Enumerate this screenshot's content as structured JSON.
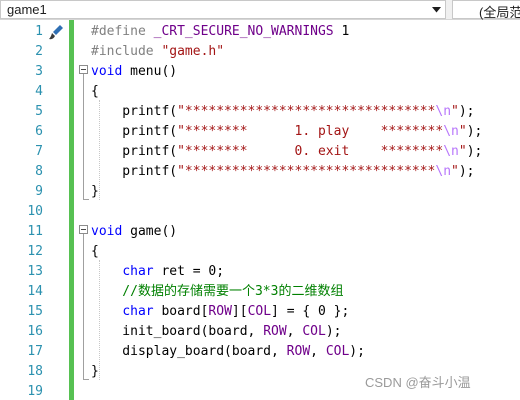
{
  "navbar": {
    "scope_value": "game1",
    "member_value": "(全局范围)"
  },
  "editor": {
    "line_numbers": [
      "1",
      "2",
      "3",
      "4",
      "5",
      "6",
      "7",
      "8",
      "9",
      "10",
      "11",
      "12",
      "13",
      "14",
      "15",
      "16",
      "17",
      "18",
      "19"
    ],
    "lines": [
      [
        {
          "t": "#define ",
          "c": "pp"
        },
        {
          "t": "_CRT_SECURE_NO_WARNINGS",
          "c": "mac"
        },
        {
          "t": " 1",
          "c": "txt"
        }
      ],
      [
        {
          "t": "#include ",
          "c": "pp"
        },
        {
          "t": "\"game.h\"",
          "c": "str"
        }
      ],
      [
        {
          "t": "void",
          "c": "kw"
        },
        {
          "t": " menu()",
          "c": "txt"
        }
      ],
      [
        {
          "t": "{",
          "c": "txt"
        }
      ],
      [
        {
          "t": "    printf(",
          "c": "txt"
        },
        {
          "t": "\"********************************",
          "c": "str"
        },
        {
          "t": "\\n",
          "c": "esc"
        },
        {
          "t": "\"",
          "c": "str"
        },
        {
          "t": ");",
          "c": "txt"
        }
      ],
      [
        {
          "t": "    printf(",
          "c": "txt"
        },
        {
          "t": "\"********      1. play    ********",
          "c": "str"
        },
        {
          "t": "\\n",
          "c": "esc"
        },
        {
          "t": "\"",
          "c": "str"
        },
        {
          "t": ");",
          "c": "txt"
        }
      ],
      [
        {
          "t": "    printf(",
          "c": "txt"
        },
        {
          "t": "\"********      0. exit    ********",
          "c": "str"
        },
        {
          "t": "\\n",
          "c": "esc"
        },
        {
          "t": "\"",
          "c": "str"
        },
        {
          "t": ");",
          "c": "txt"
        }
      ],
      [
        {
          "t": "    printf(",
          "c": "txt"
        },
        {
          "t": "\"********************************",
          "c": "str"
        },
        {
          "t": "\\n",
          "c": "esc"
        },
        {
          "t": "\"",
          "c": "str"
        },
        {
          "t": ");",
          "c": "txt"
        }
      ],
      [
        {
          "t": "}",
          "c": "txt"
        }
      ],
      [],
      [
        {
          "t": "void",
          "c": "kw"
        },
        {
          "t": " game()",
          "c": "txt"
        }
      ],
      [
        {
          "t": "{",
          "c": "txt"
        }
      ],
      [
        {
          "t": "    ",
          "c": "txt"
        },
        {
          "t": "char",
          "c": "kw"
        },
        {
          "t": " ret = 0;",
          "c": "txt"
        }
      ],
      [
        {
          "t": "    //数据的存储需要一个3*3的二维数组",
          "c": "cmt"
        }
      ],
      [
        {
          "t": "    ",
          "c": "txt"
        },
        {
          "t": "char",
          "c": "kw"
        },
        {
          "t": " board[",
          "c": "txt"
        },
        {
          "t": "ROW",
          "c": "mac"
        },
        {
          "t": "][",
          "c": "txt"
        },
        {
          "t": "COL",
          "c": "mac"
        },
        {
          "t": "] = { 0 };",
          "c": "txt"
        }
      ],
      [
        {
          "t": "    init_board(board, ",
          "c": "txt"
        },
        {
          "t": "ROW",
          "c": "mac"
        },
        {
          "t": ", ",
          "c": "txt"
        },
        {
          "t": "COL",
          "c": "mac"
        },
        {
          "t": ");",
          "c": "txt"
        }
      ],
      [
        {
          "t": "    display_board(board, ",
          "c": "txt"
        },
        {
          "t": "ROW",
          "c": "mac"
        },
        {
          "t": ", ",
          "c": "txt"
        },
        {
          "t": "COL",
          "c": "mac"
        },
        {
          "t": ");",
          "c": "txt"
        }
      ],
      [
        {
          "t": "}",
          "c": "txt"
        }
      ],
      []
    ]
  },
  "watermark": "CSDN @奋斗小温"
}
